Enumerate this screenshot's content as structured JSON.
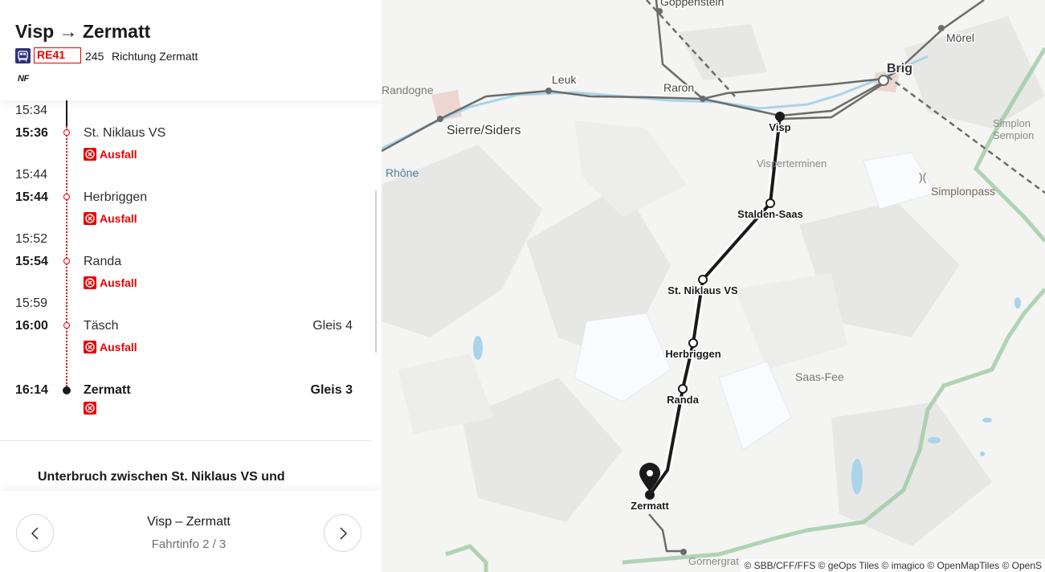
{
  "header": {
    "route_title": "Visp → Zermatt",
    "line": "RE41",
    "train_number": "245",
    "direction": "Richtung Zermatt",
    "low_floor_icon": "NF",
    "train_icon": "train-icon",
    "line_color": "#eb0000"
  },
  "stops": [
    {
      "time": "15:34"
    },
    {
      "time": "15:36",
      "station": "St. Niklaus VS",
      "status": "Ausfall"
    },
    {
      "time": "15:44",
      "kind": "arrival"
    },
    {
      "time": "15:44",
      "station": "Herbriggen",
      "status": "Ausfall"
    },
    {
      "time": "15:52",
      "kind": "arrival"
    },
    {
      "time": "15:54",
      "station": "Randa",
      "status": "Ausfall"
    },
    {
      "time": "15:59",
      "kind": "arrival"
    },
    {
      "time": "16:00",
      "station": "Täsch",
      "platform": "Gleis 4",
      "status": "Ausfall"
    },
    {
      "time": "16:14",
      "station": "Zermatt",
      "platform": "Gleis 3"
    }
  ],
  "disruption": {
    "title": "Unterbruch zwischen St. Niklaus VS und"
  },
  "footer": {
    "route": "Visp – Zermatt",
    "info": "Fahrtinfo 2 / 3",
    "prev_icon": "chevron-left-icon",
    "next_icon": "chevron-right-icon"
  },
  "map": {
    "place_labels": {
      "goppenstein": "Goppenstein",
      "morel": "Mörel",
      "randogne": "Randogne",
      "leuk": "Leuk",
      "raron": "Raron",
      "brig": "Brig",
      "sierre": "Sierre/Siders",
      "rhone": "Rhône",
      "simplon1": "Simplon",
      "simplon2": "Sempion",
      "visperterminen": "Visperterminen",
      "simplonpass": "Simplonpass",
      "saasfee": "Saas-Fee",
      "gornergrat": "Gornergrat"
    },
    "route_stations": {
      "visp": "Visp",
      "stalden": "Stalden-Saas",
      "stniklaus": "St. Niklaus VS",
      "herbriggen": "Herbriggen",
      "randa": "Randa",
      "zermatt": "Zermatt"
    },
    "attribution": "© SBB/CFF/FFS  © geOps Tiles  © imagico  © OpenMapTiles  © OpenS",
    "colors": {
      "route": "#1a1a1a",
      "rail": "#6b6b6b",
      "water": "#a9d4ea",
      "border": "#8fc49a"
    }
  }
}
